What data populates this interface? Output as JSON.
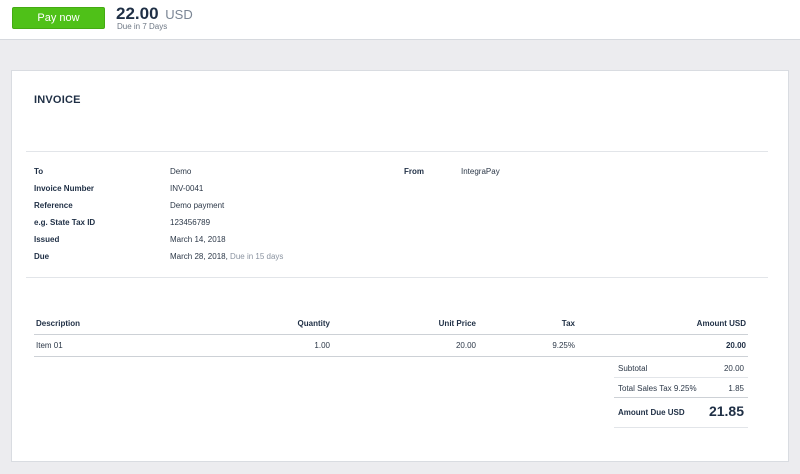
{
  "header": {
    "pay_button": "Pay now",
    "amount": "22.00",
    "currency": "USD",
    "due_note": "Due in 7 Days"
  },
  "invoice": {
    "title": "INVOICE",
    "to_label": "To",
    "to_value": "Demo",
    "number_label": "Invoice Number",
    "number_value": "INV-0041",
    "reference_label": "Reference",
    "reference_value": "Demo payment",
    "taxid_label": "e.g. State Tax ID",
    "taxid_value": "123456789",
    "issued_label": "Issued",
    "issued_value": "March 14, 2018",
    "due_label": "Due",
    "due_value": "March 28, 2018,",
    "due_relative": "Due in 15 days",
    "from_label": "From",
    "from_value": "IntegraPay"
  },
  "table": {
    "headers": {
      "description": "Description",
      "quantity": "Quantity",
      "unit_price": "Unit Price",
      "tax": "Tax",
      "amount": "Amount USD"
    },
    "rows": [
      {
        "description": "Item 01",
        "quantity": "1.00",
        "unit_price": "20.00",
        "tax": "9.25%",
        "amount": "20.00"
      }
    ]
  },
  "totals": {
    "subtotal_label": "Subtotal",
    "subtotal_value": "20.00",
    "tax_label": "Total Sales Tax 9.25%",
    "tax_value": "1.85",
    "amount_due_label": "Amount Due USD",
    "amount_due_value": "21.85"
  },
  "colors": {
    "pay_button": "#4fc118",
    "text_dark": "#1f2f45",
    "page_background": "#ececef"
  }
}
